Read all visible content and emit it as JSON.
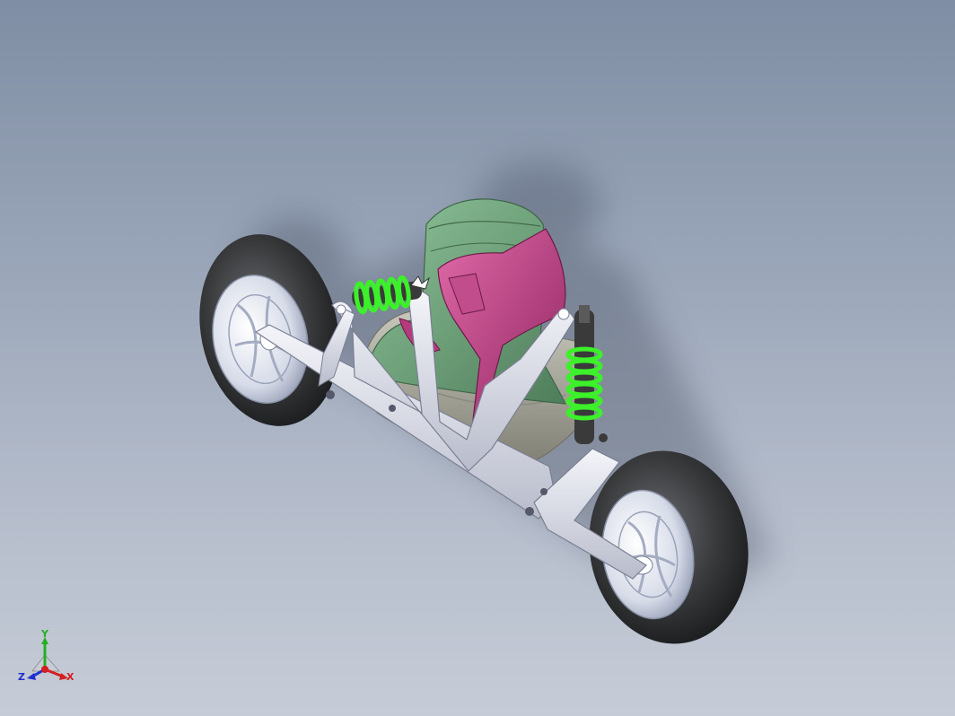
{
  "viewport": {
    "background_top": "#7f8ea4",
    "background_bottom": "#c6ccd7"
  },
  "model": {
    "parts": [
      "front-wheel",
      "rear-wheel",
      "chassis-frame",
      "boot",
      "front-shock",
      "rear-shock"
    ],
    "colors": {
      "tire": "#3a3b3d",
      "rim": "#dfe3ee",
      "frame": "#e4e6ee",
      "boot_shell": "#6f9d78",
      "boot_cuff": "#b53a7e",
      "boot_base": "#a8a89c",
      "spring": "#3cf02a",
      "damper": "#3a3a3a"
    }
  },
  "triad": {
    "x_label": "X",
    "y_label": "Y",
    "z_label": "Z",
    "x_color": "#d42020",
    "y_color": "#22b022",
    "z_color": "#2030d0"
  }
}
